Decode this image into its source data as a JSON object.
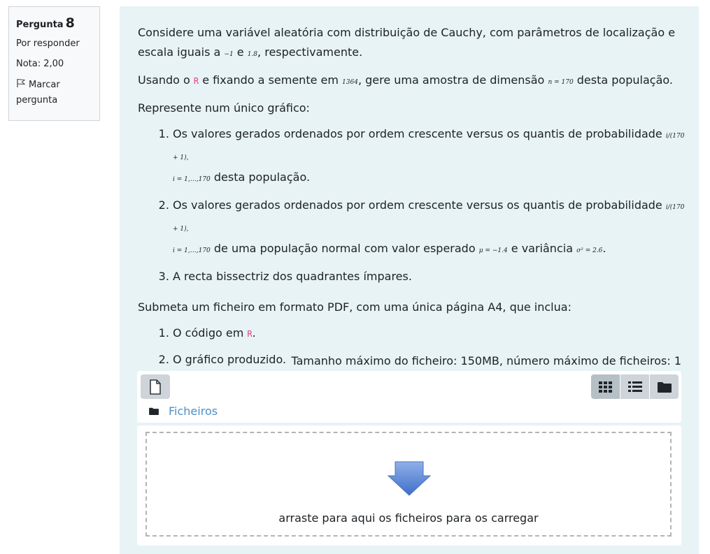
{
  "info": {
    "question_label": "Pergunta",
    "question_number": "8",
    "state": "Por responder",
    "grade": "Nota: 2,00",
    "flag_label": "Marcar pergunta"
  },
  "question": {
    "p1_a": "Considere uma variável aleatória com distribuição de Cauchy, com parâmetros de localização e escala iguais a ",
    "p1_loc": "−1",
    "p1_b": " e ",
    "p1_scale": "1.8",
    "p1_c": ", respectivamente.",
    "p2_a": "Usando o ",
    "p2_r": "R",
    "p2_b": " e fixando a semente em ",
    "p2_seed": "1364",
    "p2_c": ", gere uma amostra de dimensão ",
    "p2_n": "n = 170",
    "p2_d": " desta população.",
    "p3": "Represente num único gráfico:",
    "item1_a": "Os valores gerados ordenados por ordem crescente versus os quantis de probabilidade ",
    "item1_prob": "i/(170 + 1),",
    "item1_i": "i = 1,…,170",
    "item1_b": " desta população.",
    "item2_a": "Os valores gerados ordenados por ordem crescente versus os quantis de probabilidade ",
    "item2_prob": "i/(170 + 1),",
    "item2_i": "i = 1,…,170",
    "item2_b": " de uma população normal com valor esperado ",
    "item2_mu": "μ = −1.4",
    "item2_c": " e variância ",
    "item2_var": "σ² = 2.6",
    "item2_d": ".",
    "item3": "A recta bissectriz dos quadrantes ímpares.",
    "p4": "Submeta um ficheiro em formato PDF, com uma única página A4, que inclua:",
    "sub1_a": "O código em ",
    "sub1_r": "R",
    "sub1_b": ".",
    "sub2": "O gráfico produzido."
  },
  "filemanager": {
    "max_size": "Tamanho máximo do ficheiro: 150MB, número máximo de ficheiros: 1",
    "path_label": "Ficheiros",
    "drop_text": "arraste para aqui os ficheiros para os carregar",
    "add_icon": "file-icon",
    "view_icons": [
      "grid-icon",
      "list-icon",
      "folder-icon"
    ],
    "accent_color": "#4f8fc6"
  }
}
